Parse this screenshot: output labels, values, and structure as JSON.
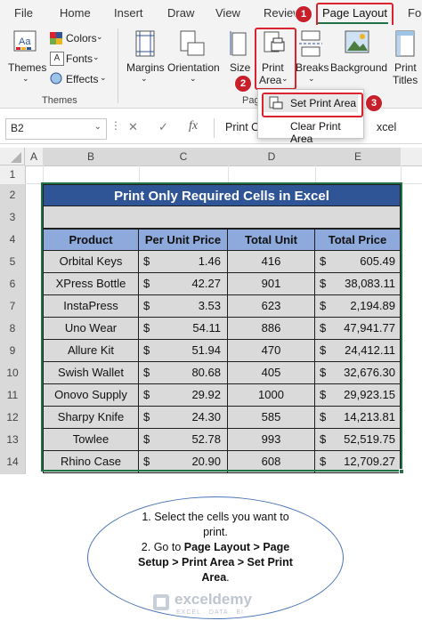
{
  "ribbon_tabs": {
    "file": "File",
    "home": "Home",
    "insert": "Insert",
    "draw": "Draw",
    "view": "View",
    "review": "Review",
    "page_layout": "Page Layout",
    "formulas": "Fo"
  },
  "themes_group": {
    "themes": "Themes",
    "colors": "Colors",
    "fonts": "Fonts",
    "effects": "Effects",
    "label": "Themes"
  },
  "page_setup_group": {
    "margins": "Margins",
    "orientation": "Orientation",
    "size": "Size",
    "print_area_line1": "Print",
    "print_area_line2": "Area",
    "breaks": "Breaks",
    "background": "Background",
    "print_titles_line1": "Print",
    "print_titles_line2": "Titles",
    "label_fragment": "Pag"
  },
  "dropdown": {
    "set_print_area": "Set Print Area",
    "clear_print_area": "Clear Print Area"
  },
  "badges": {
    "one": "1",
    "two": "2",
    "three": "3"
  },
  "formula_bar": {
    "name_box": "B2",
    "cancel": "✕",
    "enter": "✓",
    "fx": "fx",
    "content_left": "Print O",
    "content_right": "xcel"
  },
  "columns": [
    "A",
    "B",
    "C",
    "D",
    "E"
  ],
  "rows": [
    "1",
    "2",
    "3",
    "4",
    "5",
    "6",
    "7",
    "8",
    "9",
    "10",
    "11",
    "12",
    "13",
    "14"
  ],
  "table": {
    "title": "Print Only Required Cells in Excel",
    "headers": [
      "Product",
      "Per Unit Price",
      "Total Unit",
      "Total Price"
    ],
    "currency": "$",
    "data": [
      [
        "Orbital Keys",
        "1.46",
        "416",
        "605.49"
      ],
      [
        "XPress Bottle",
        "42.27",
        "901",
        "38,083.11"
      ],
      [
        "InstaPress",
        "3.53",
        "623",
        "2,194.89"
      ],
      [
        "Uno Wear",
        "54.11",
        "886",
        "47,941.77"
      ],
      [
        "Allure Kit",
        "51.94",
        "470",
        "24,412.11"
      ],
      [
        "Swish Wallet",
        "80.68",
        "405",
        "32,676.30"
      ],
      [
        "Onovo Supply",
        "29.92",
        "1000",
        "29,923.15"
      ],
      [
        "Sharpy Knife",
        "24.30",
        "585",
        "14,213.81"
      ],
      [
        "Towlee",
        "52.78",
        "993",
        "52,519.75"
      ],
      [
        "Rhino Case",
        "20.90",
        "608",
        "12,709.27"
      ]
    ]
  },
  "note": {
    "line1": "1. Select the cells you want to",
    "line2": "print.",
    "line3_prefix": "2. Go to ",
    "line3_bold": "Page Layout > Page",
    "line4_bold": "Setup > Print Area > Set Print",
    "line5_bold": "Area",
    "line5_suffix": "."
  },
  "watermark": {
    "name": "exceldemy",
    "tagline": "EXCEL · DATA · BI"
  },
  "colors": {
    "title_bar": "#2f5597",
    "header_fill": "#8ea9db",
    "body_fill": "#dadada",
    "highlight_red": "#d9232e",
    "selection_green": "#217346"
  }
}
